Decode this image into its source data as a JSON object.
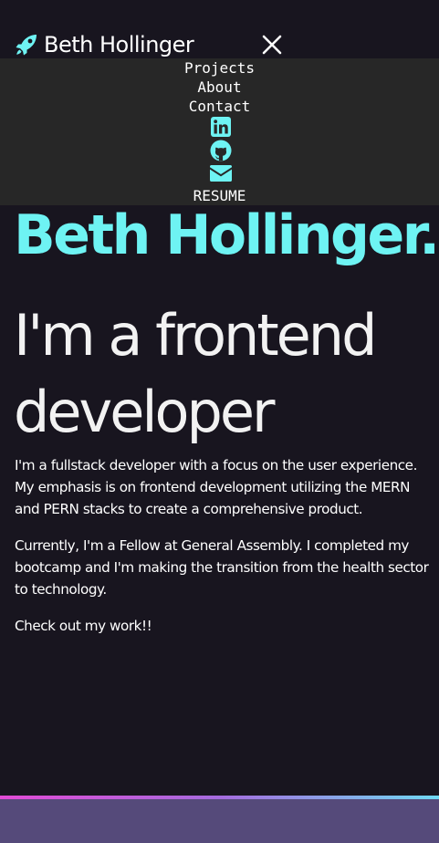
{
  "header": {
    "brand_name": "Beth Hollinger",
    "brand_icon": "rocket-icon",
    "close_icon": "close-icon"
  },
  "nav": {
    "links": [
      "Projects",
      "About",
      "Contact"
    ],
    "icons": [
      "linkedin-icon",
      "github-icon",
      "envelope-icon"
    ],
    "resume_label": "RESUME"
  },
  "hero": {
    "name": "Beth Hollinger.",
    "title": "I'm a frontend developer",
    "paragraphs": [
      "I'm a fullstack developer with a focus on the user experience. My emphasis is on frontend development utilizing the MERN and PERN stacks to create a comprehensive product.",
      "Currently, I'm a Fellow at General Assembly. I completed my bootcamp and I'm making the transition from the health sector to technology.",
      "Check out my work!!"
    ]
  },
  "colors": {
    "background": "#18151f",
    "nav_panel": "#272727",
    "accent_cyan": "#6ef3f3",
    "footer": "#554a7a",
    "footer_stripe_start": "#e24bd6",
    "footer_stripe_end": "#6fd9f2"
  }
}
